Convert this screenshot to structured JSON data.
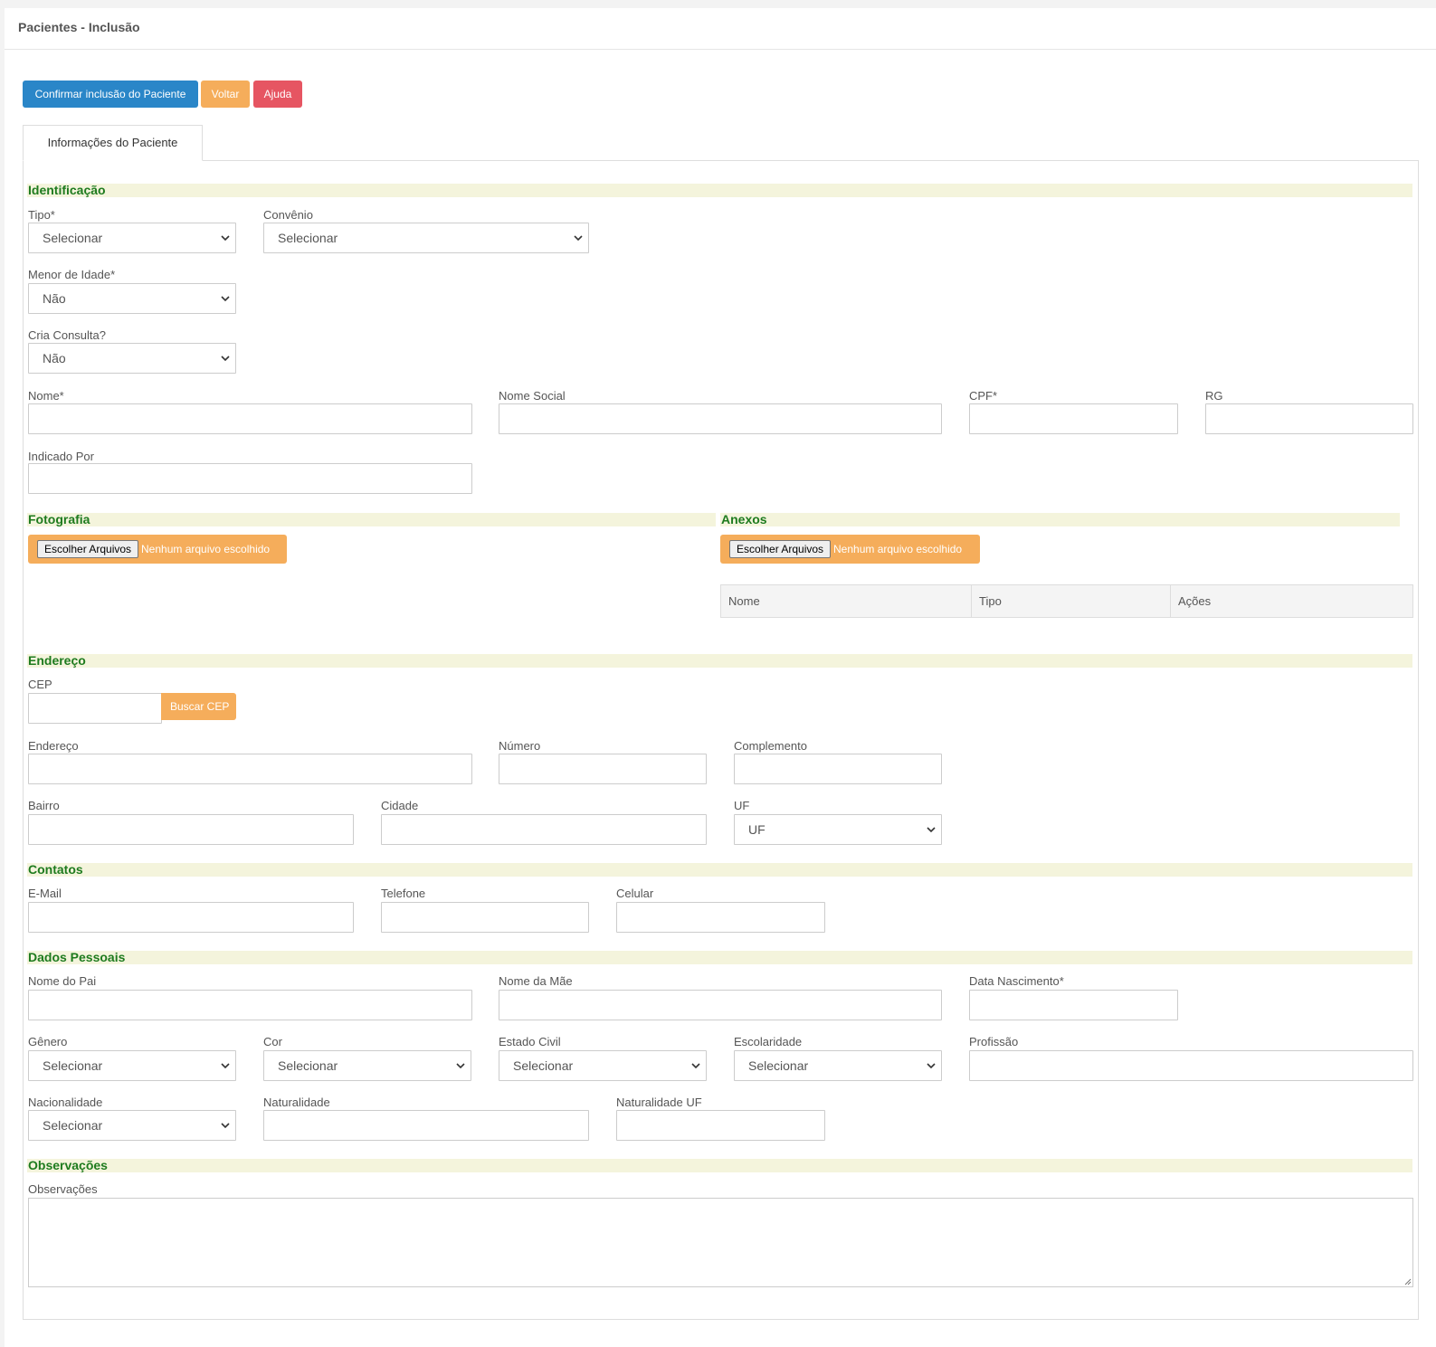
{
  "page": {
    "title": "Pacientes - Inclusão"
  },
  "toolbar": {
    "confirm_label": "Confirmar inclusão do Paciente",
    "back_label": "Voltar",
    "help_label": "Ajuda"
  },
  "tabs": [
    {
      "label": "Informações do Paciente"
    }
  ],
  "sections": {
    "identificacao": "Identificação",
    "fotografia": "Fotografia",
    "anexos": "Anexos",
    "endereco": "Endereço",
    "contatos": "Contatos",
    "dados_pessoais": "Dados Pessoais",
    "observacoes": "Observações"
  },
  "fields": {
    "tipo": {
      "label": "Tipo*",
      "value": "Selecionar"
    },
    "convenio": {
      "label": "Convênio",
      "value": "Selecionar"
    },
    "menor_idade": {
      "label": "Menor de Idade*",
      "value": "Não"
    },
    "cria_consulta": {
      "label": "Cria Consulta?",
      "value": "Não"
    },
    "nome": {
      "label": "Nome*",
      "value": ""
    },
    "nome_social": {
      "label": "Nome Social",
      "value": ""
    },
    "cpf": {
      "label": "CPF*",
      "value": ""
    },
    "rg": {
      "label": "RG",
      "value": ""
    },
    "indicado_por": {
      "label": "Indicado Por",
      "value": ""
    },
    "cep": {
      "label": "CEP",
      "value": ""
    },
    "endereco": {
      "label": "Endereço",
      "value": ""
    },
    "numero": {
      "label": "Número",
      "value": ""
    },
    "complemento": {
      "label": "Complemento",
      "value": ""
    },
    "bairro": {
      "label": "Bairro",
      "value": ""
    },
    "cidade": {
      "label": "Cidade",
      "value": ""
    },
    "uf": {
      "label": "UF",
      "value": "UF"
    },
    "email": {
      "label": "E-Mail",
      "value": ""
    },
    "telefone": {
      "label": "Telefone",
      "value": ""
    },
    "celular": {
      "label": "Celular",
      "value": ""
    },
    "nome_pai": {
      "label": "Nome do Pai",
      "value": ""
    },
    "nome_mae": {
      "label": "Nome da Mãe",
      "value": ""
    },
    "data_nascimento": {
      "label": "Data Nascimento*",
      "value": ""
    },
    "genero": {
      "label": "Gênero",
      "value": "Selecionar"
    },
    "cor": {
      "label": "Cor",
      "value": "Selecionar"
    },
    "estado_civil": {
      "label": "Estado Civil",
      "value": "Selecionar"
    },
    "escolaridade": {
      "label": "Escolaridade",
      "value": "Selecionar"
    },
    "profissao": {
      "label": "Profissão",
      "value": ""
    },
    "nacionalidade": {
      "label": "Nacionalidade",
      "value": "Selecionar"
    },
    "naturalidade": {
      "label": "Naturalidade",
      "value": ""
    },
    "naturalidade_uf": {
      "label": "Naturalidade UF",
      "value": ""
    },
    "observacoes": {
      "label": "Observações",
      "value": ""
    }
  },
  "buscar_cep_label": "Buscar CEP",
  "file_input": {
    "button_label": "Escolher Arquivos",
    "empty_text": "Nenhum arquivo escolhido"
  },
  "anexos_table": {
    "columns": [
      "Nome",
      "Tipo",
      "Ações"
    ]
  },
  "colors": {
    "primary": "#2a86c8",
    "warning": "#f5ad5b",
    "danger": "#e65562",
    "section_text": "#1e7b1e",
    "section_bg": "#f4f4dc"
  },
  "icons": {
    "select_arrow": "chevron-down-icon",
    "textarea_resize": "resize-grip-icon"
  }
}
